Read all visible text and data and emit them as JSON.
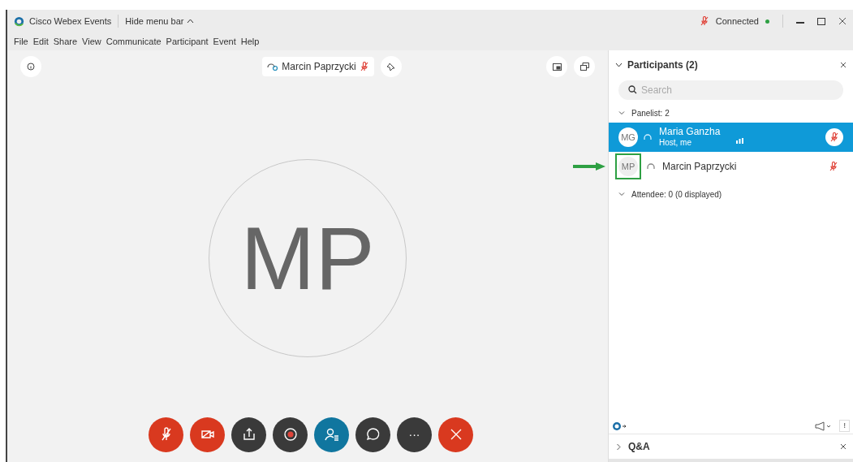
{
  "window": {
    "title": "Cisco Webex Events",
    "menu_toggle": "Hide menu bar",
    "status": "Connected",
    "mic_muted": true
  },
  "menu": [
    "File",
    "Edit",
    "Share",
    "View",
    "Communicate",
    "Participant",
    "Event",
    "Help"
  ],
  "stage": {
    "speaker": "Marcin Paprzycki",
    "speaker_muted": true,
    "avatar": "MP"
  },
  "controls": [
    {
      "kind": "mute",
      "color": "#d9391f"
    },
    {
      "kind": "video",
      "color": "#d9391f"
    },
    {
      "kind": "share",
      "color": "#3a3a3a"
    },
    {
      "kind": "record",
      "color": "#3a3a3a"
    },
    {
      "kind": "participants",
      "color": "#10769f"
    },
    {
      "kind": "chat",
      "color": "#3a3a3a"
    },
    {
      "kind": "more",
      "color": "#3a3a3a",
      "label": "···"
    },
    {
      "kind": "leave",
      "color": "#d9391f"
    }
  ],
  "participants_panel": {
    "title": "Participants (2)",
    "search": {
      "placeholder": "Search"
    },
    "groups": [
      {
        "label": "Panelist: 2",
        "expanded": true,
        "members": [
          {
            "initials": "MG",
            "name": "Maria Ganzha",
            "role": "Host, me",
            "selected": true,
            "muted": true,
            "speaking": true,
            "highlighted": false
          },
          {
            "initials": "MP",
            "name": "Marcin Paprzycki",
            "selected": false,
            "muted": true,
            "speaking": false,
            "highlighted": true
          }
        ]
      },
      {
        "label": "Attendee: 0 (0 displayed)",
        "expanded": true
      }
    ]
  },
  "footer": {
    "alert_label": "!"
  },
  "qa_panel": {
    "title": "Q&A",
    "expanded": false
  }
}
